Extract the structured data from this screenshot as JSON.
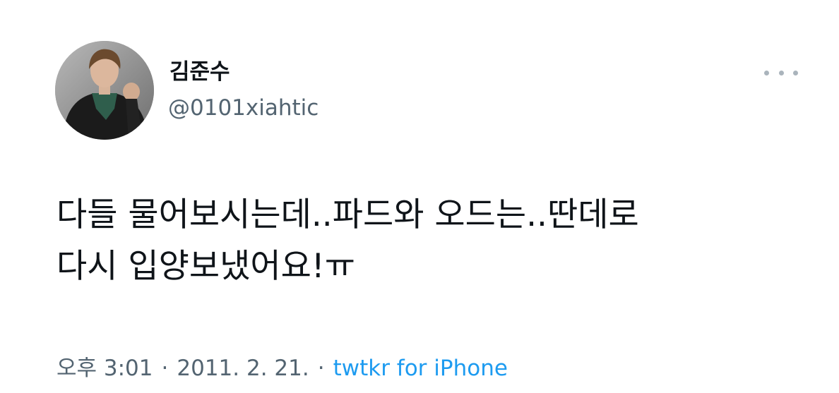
{
  "tweet": {
    "author": {
      "display_name": "김준수",
      "handle": "@0101xiahtic"
    },
    "more_icon": "more-horizontal-icon",
    "text_lines": [
      "다들 물어보시는데..파드와 오드는..딴데로",
      "다시 입양보냈어요!ㅠ"
    ],
    "meta": {
      "time": "오후 3:01",
      "separator": "·",
      "date": "2011. 2. 21.",
      "source": "twtkr for iPhone"
    }
  },
  "colors": {
    "text_primary": "#0f1419",
    "text_secondary": "#536471",
    "link": "#1d9bf0",
    "more_dots": "#aab4bc"
  }
}
